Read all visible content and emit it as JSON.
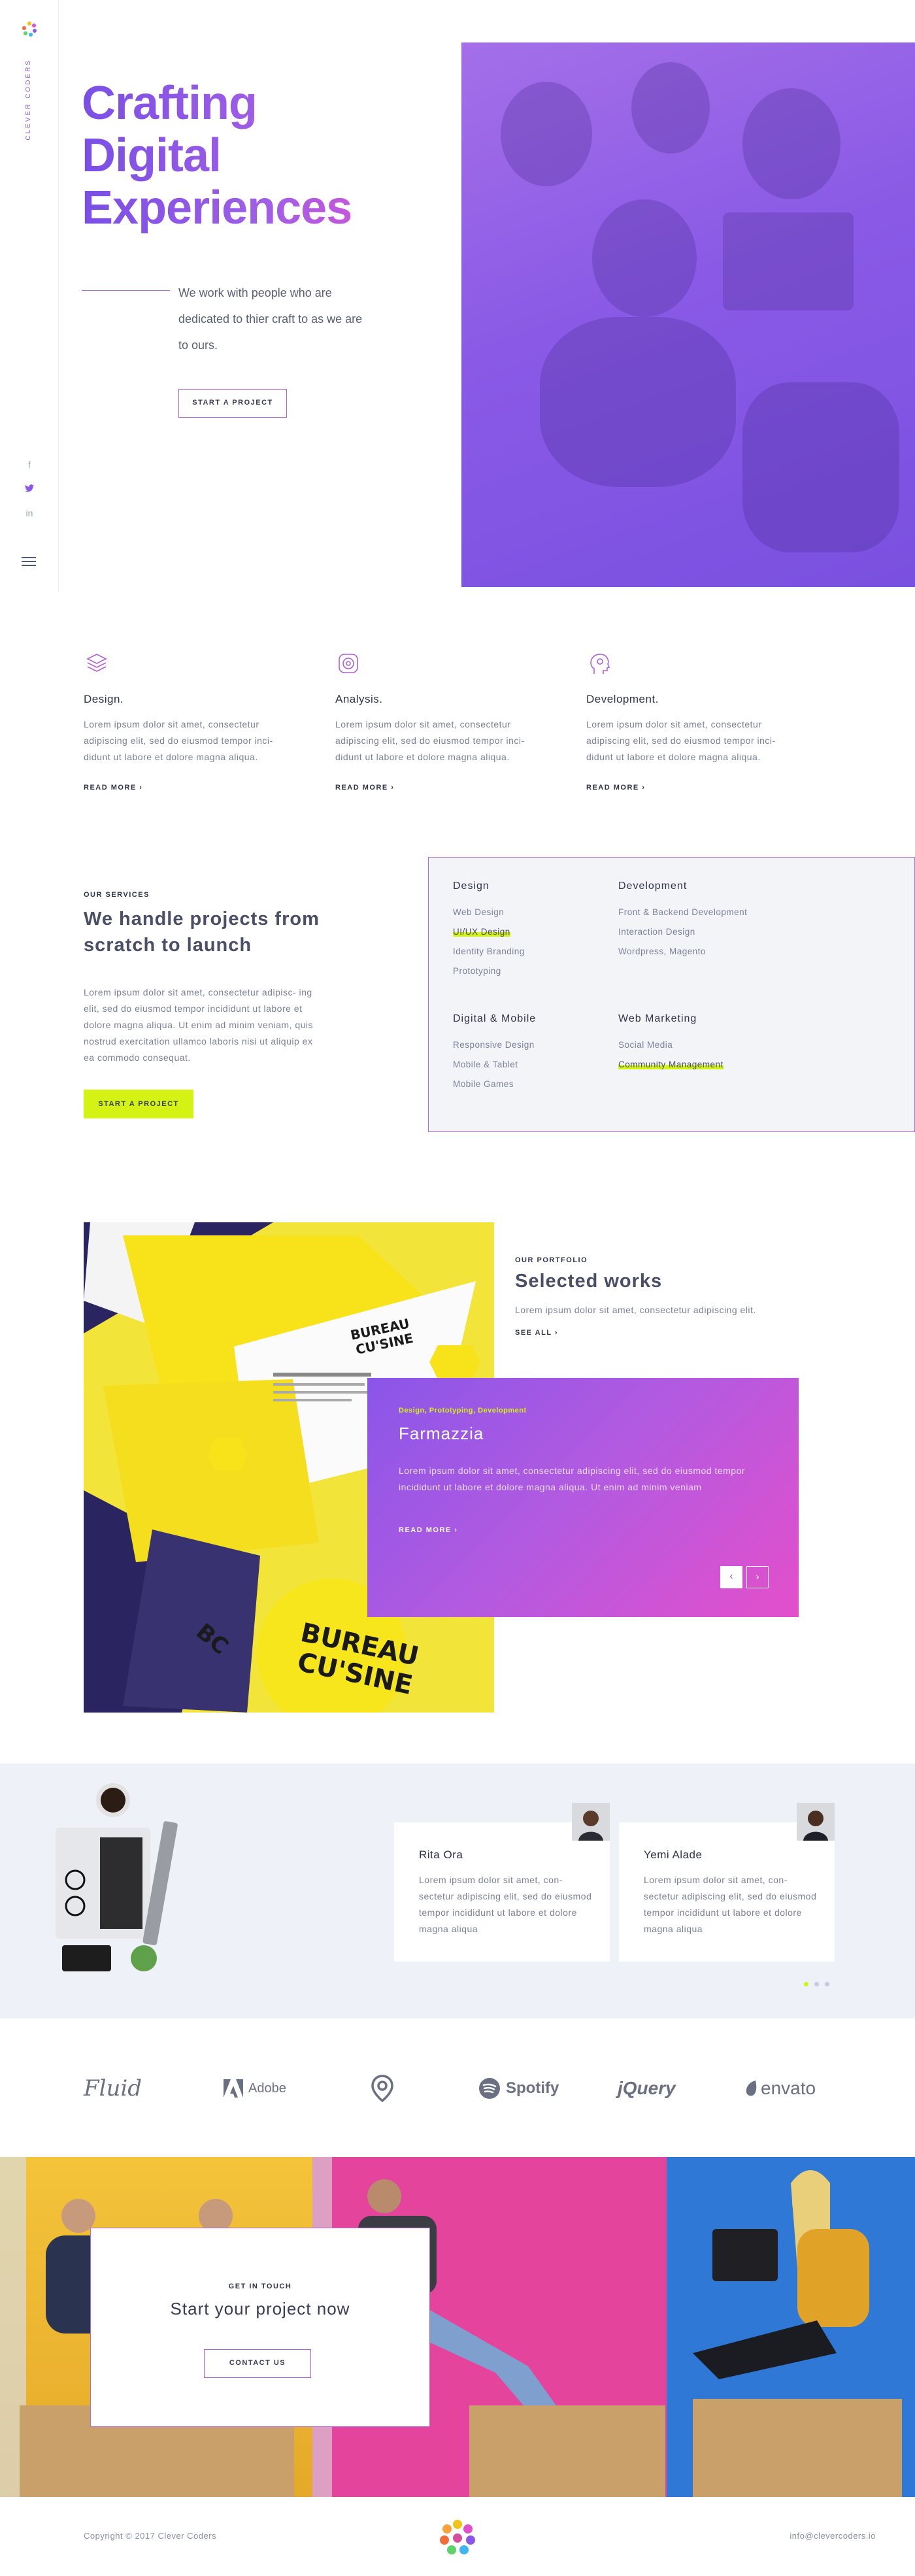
{
  "brand": {
    "name": "CLEVER CODERS"
  },
  "sidebar": {
    "social": [
      {
        "name": "facebook",
        "glyph": "f"
      },
      {
        "name": "twitter",
        "glyph": "🐦"
      },
      {
        "name": "linkedin",
        "glyph": "in"
      }
    ],
    "menu_icon": "hamburger-icon"
  },
  "hero": {
    "title_line1": "Crafting",
    "title_line2": "Digital",
    "title_line3": "Experiences",
    "text": "We work with people who are dedicated to thier craft to  as we are to ours.",
    "button": "START A PROJECT"
  },
  "features": [
    {
      "icon": "layers-icon",
      "title": "Design.",
      "text": "Lorem ipsum dolor sit amet, consectetur adipiscing elit, sed do eiusmod tempor inci- didunt ut labore et dolore magna aliqua.",
      "more": "READ MORE ›"
    },
    {
      "icon": "analysis-icon",
      "title": "Analysis.",
      "text": "Lorem ipsum dolor sit amet, consectetur adipiscing elit, sed do eiusmod tempor inci- didunt ut labore et dolore magna aliqua.",
      "more": "READ MORE ›"
    },
    {
      "icon": "head-gear-icon",
      "title": "Development.",
      "text": "Lorem ipsum dolor sit amet, consectetur adipiscing elit, sed do eiusmod tempor inci- didunt ut labore et dolore magna aliqua.",
      "more": "READ MORE ›"
    }
  ],
  "services": {
    "eyebrow": "OUR SERVICES",
    "title": "We handle projects from scratch to launch",
    "text": "Lorem ipsum dolor sit amet, consectetur adipisc- ing elit, sed do eiusmod tempor incididunt ut labore et dolore magna aliqua. Ut enim ad minim veniam, quis nostrud exercitation ullamco laboris nisi ut aliquip ex ea commodo consequat.",
    "button": "START A PROJECT",
    "groups": [
      {
        "title": "Design",
        "items": [
          "Web Design",
          "UI/UX Design",
          "Identity Branding",
          "Prototyping"
        ]
      },
      {
        "title": "Development",
        "items": [
          "Front & Backend Development",
          "Interaction Design",
          "Wordpress, Magento"
        ]
      },
      {
        "title": "Digital & Mobile",
        "items": [
          "Responsive Design",
          "Mobile & Tablet",
          "Mobile Games"
        ]
      },
      {
        "title": "Web Marketing",
        "items": [
          "Social Media",
          "Community Management"
        ]
      }
    ]
  },
  "portfolio": {
    "eyebrow": "OUR PORTFOLIO",
    "title": "Selected works",
    "subtitle": "Lorem ipsum dolor sit amet, consectetur adipiscing elit.",
    "see_all": "SEE ALL ›",
    "image_text": [
      "BUREAU",
      "CU'SINE",
      "BC"
    ],
    "project": {
      "tags": "Design, Prototyping, Development",
      "title": "Farmazzia",
      "text": "Lorem ipsum dolor sit amet, consectetur adipiscing elit, sed do eiusmod tempor incididunt ut labore et dolore magna aliqua. Ut enim ad minim veniam",
      "more": "READ MORE ›",
      "prev": "‹",
      "next": "›"
    }
  },
  "testimonials": [
    {
      "name": "Rita Ora",
      "text": "Lorem ipsum dolor sit amet, con- sectetur adipiscing elit, sed do eiusmod tempor incididunt ut labore et dolore magna aliqua"
    },
    {
      "name": "Yemi Alade",
      "text": "Lorem ipsum dolor sit amet, con- sectetur adipiscing elit, sed do eiusmod tempor incididunt ut labore et dolore magna aliqua"
    }
  ],
  "clients": [
    {
      "name": "Fluid",
      "icon": ""
    },
    {
      "name": "Adobe",
      "icon": "adobe-icon"
    },
    {
      "name": "",
      "icon": "map-pin-icon"
    },
    {
      "name": "Spotify",
      "icon": "spotify-icon"
    },
    {
      "name": "jQuery",
      "icon": ""
    },
    {
      "name": "envato",
      "icon": "envato-leaf-icon"
    }
  ],
  "contact": {
    "eyebrow": "GET IN TOUCH",
    "title": "Start your project now",
    "button": "CONTACT US"
  },
  "footer": {
    "copyright": "Copyright © 2017 Clever Coders",
    "email": "info@clevercoders.io"
  },
  "colors": {
    "accent_purple": "#8a56e8",
    "accent_pink": "#e34fcb",
    "accent_lime": "#d4f314"
  }
}
